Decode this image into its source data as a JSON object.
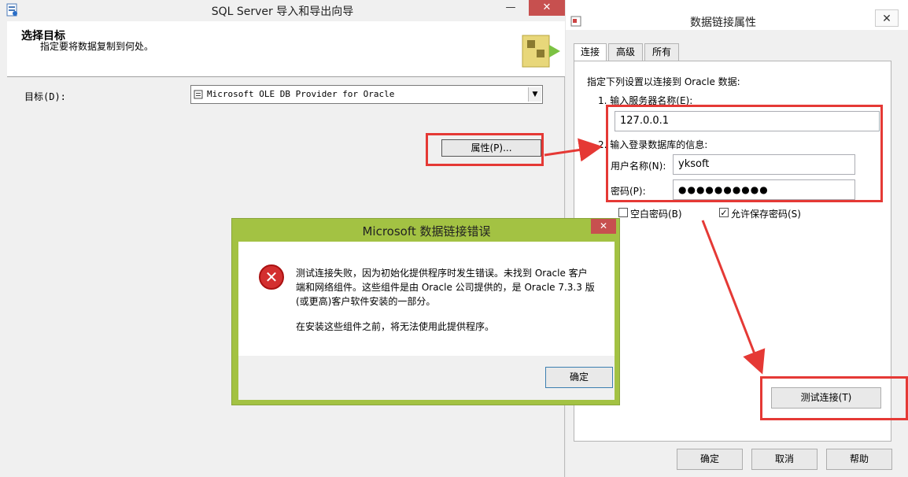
{
  "wizard": {
    "title": "SQL Server 导入和导出向导",
    "heading": "选择目标",
    "subheading": "指定要将数据复制到何处。",
    "minimize": "—",
    "close": "✕",
    "target_label": "目标(D):",
    "target_value": "Microsoft OLE DB Provider for Oracle",
    "properties_button": "属性(P)..."
  },
  "dialog": {
    "title": "数据链接属性",
    "close": "✕",
    "tabs": [
      "连接",
      "高级",
      "所有"
    ],
    "instruction": "指定下列设置以连接到 Oracle 数据:",
    "step1": "1. 输入服务器名称(E):",
    "server": "127.0.0.1",
    "step2": "2. 输入登录数据库的信息:",
    "username_label": "用户名称(N):",
    "username": "yksoft",
    "password_label": "密码(P):",
    "password": "●●●●●●●●●●",
    "blank_password_label": "空白密码(B)",
    "blank_password_checked": false,
    "allow_save_label": "允许保存密码(S)",
    "allow_save_checked": true,
    "test_button": "测试连接(T)",
    "ok_button": "确定",
    "cancel_button": "取消",
    "help_button": "帮助"
  },
  "error": {
    "title": "Microsoft 数据链接错误",
    "close": "✕",
    "line1": "测试连接失败，因为初始化提供程序时发生错误。未找到 Oracle 客户",
    "line2": "端和网络组件。这些组件是由 Oracle 公司提供的，是 Oracle 7.3.3 版",
    "line3": "(或更高)客户软件安装的一部分。",
    "line4": "在安装这些组件之前，将无法使用此提供程序。",
    "ok_button": "确定"
  },
  "colors": {
    "annotation_red": "#e53935",
    "error_frame": "#a3c243",
    "close_red": "#c7504f"
  }
}
